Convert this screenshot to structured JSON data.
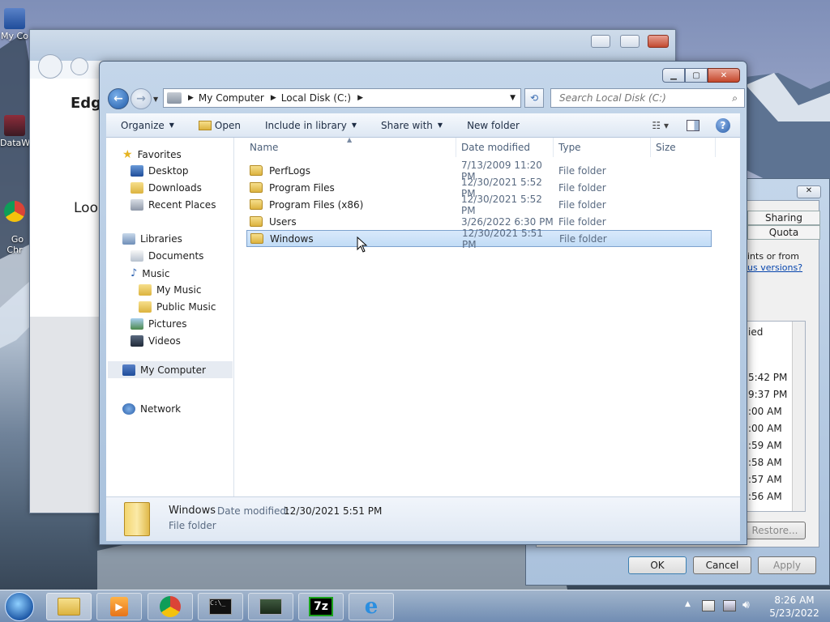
{
  "desktop": {
    "icons": [
      {
        "label": "My Co"
      },
      {
        "label": "DataW"
      },
      {
        "label": "Go\nChr"
      }
    ]
  },
  "bg_window": {
    "heading": "Edge",
    "text": "Look"
  },
  "explorer": {
    "address": {
      "crumbs": [
        "My Computer",
        "Local Disk (C:)"
      ]
    },
    "search": {
      "placeholder": "Search Local Disk (C:)"
    },
    "toolbar": {
      "organize": "Organize",
      "open": "Open",
      "include": "Include in library",
      "share": "Share with",
      "new_folder": "New folder"
    },
    "nav": {
      "favorites": "Favorites",
      "desktop": "Desktop",
      "downloads": "Downloads",
      "recent": "Recent Places",
      "libraries": "Libraries",
      "documents": "Documents",
      "music": "Music",
      "my_music": "My Music",
      "public_music": "Public Music",
      "pictures": "Pictures",
      "videos": "Videos",
      "computer": "My Computer",
      "network": "Network"
    },
    "columns": {
      "name": "Name",
      "date": "Date modified",
      "type": "Type",
      "size": "Size"
    },
    "files": [
      {
        "name": "PerfLogs",
        "date": "7/13/2009 11:20 PM",
        "type": "File folder"
      },
      {
        "name": "Program Files",
        "date": "12/30/2021 5:52 PM",
        "type": "File folder"
      },
      {
        "name": "Program Files (x86)",
        "date": "12/30/2021 5:52 PM",
        "type": "File folder"
      },
      {
        "name": "Users",
        "date": "3/26/2022 6:30 PM",
        "type": "File folder"
      },
      {
        "name": "Windows",
        "date": "12/30/2021 5:51 PM",
        "type": "File folder"
      }
    ],
    "details": {
      "name": "Windows",
      "date_label": "Date modified:",
      "date": "12/30/2021 5:51 PM",
      "type": "File folder"
    }
  },
  "props_dialog": {
    "tab_sharing": "Sharing",
    "tab_quota": "Quota",
    "text1": "ints or from",
    "link": "us versions?",
    "list_header": "ied",
    "times": [
      "5:42 PM",
      "9:37 PM",
      ":00 AM",
      ":00 AM",
      ":59 AM",
      ":58 AM",
      ":57 AM",
      ":56 AM"
    ],
    "restore": "Restore...",
    "ok": "OK",
    "cancel": "Cancel",
    "apply": "Apply"
  },
  "taskbar": {
    "time": "8:26 AM",
    "date": "5/23/2022"
  }
}
